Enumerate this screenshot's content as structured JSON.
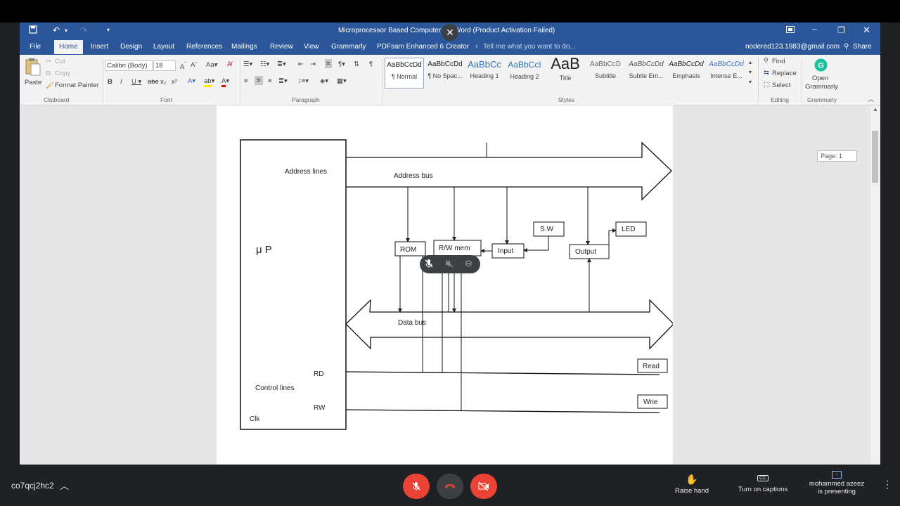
{
  "word": {
    "title": "Microprocessor Based Computer s... Word (Product Activation Failed)",
    "menu_tabs": [
      "File",
      "Home",
      "Insert",
      "Design",
      "Layout",
      "References",
      "Mailings",
      "Review",
      "View",
      "Grammarly",
      "PDFsam Enhanced 6 Creator"
    ],
    "tell_me": "Tell me what you want to do...",
    "account": "nodered123.1983@gmail.com",
    "share": "Share",
    "clipboard": {
      "paste": "Paste",
      "cut": "Cut",
      "copy": "Copy",
      "format_painter": "Format Painter",
      "group": "Clipboard"
    },
    "font": {
      "name": "Calibri (Body)",
      "size": "18",
      "group": "Font"
    },
    "paragraph_group": "Paragraph",
    "styles": [
      {
        "sample": "AaBbCcDd",
        "name": "¶ Normal"
      },
      {
        "sample": "AaBbCcDd",
        "name": "¶ No Spac..."
      },
      {
        "sample": "AaBbCc",
        "name": "Heading 1"
      },
      {
        "sample": "AaBbCcI",
        "name": "Heading 2"
      },
      {
        "sample": "AaB",
        "name": "Title"
      },
      {
        "sample": "AaBbCcD",
        "name": "Subtitle"
      },
      {
        "sample": "AaBbCcDd",
        "name": "Subtle Em..."
      },
      {
        "sample": "AaBbCcDd",
        "name": "Emphasis"
      },
      {
        "sample": "AaBbCcDd",
        "name": "Intense E..."
      }
    ],
    "styles_group": "Styles",
    "editing": {
      "find": "Find",
      "replace": "Replace",
      "select": "Select",
      "group": "Editing"
    },
    "grammarly": {
      "open": "Open",
      "name": "Grammarly",
      "group": "Grammarly"
    },
    "page_badge": "Page: 1"
  },
  "diagram": {
    "address_lines": "Address lines",
    "address_bus": "Address bus",
    "mu_p": "μ P",
    "rom": "ROM",
    "rw_mem": "R/W mem",
    "input": "Input",
    "sw": "S.W",
    "output": "Output",
    "led": "LED",
    "data_bus": "Data bus",
    "rd": "RD",
    "control_lines": "Control lines",
    "rw": "RW",
    "clk": "Clk",
    "read": "Read",
    "write": "Wrie"
  },
  "meet": {
    "meeting_code": "co7qcj2hc2",
    "raise_hand": "Raise hand",
    "captions": "Turn on captions",
    "presenter": "mohammed azeez",
    "presenting": "is presenting",
    "colors": {
      "red": "#ea4335",
      "bar": "#202124"
    }
  }
}
